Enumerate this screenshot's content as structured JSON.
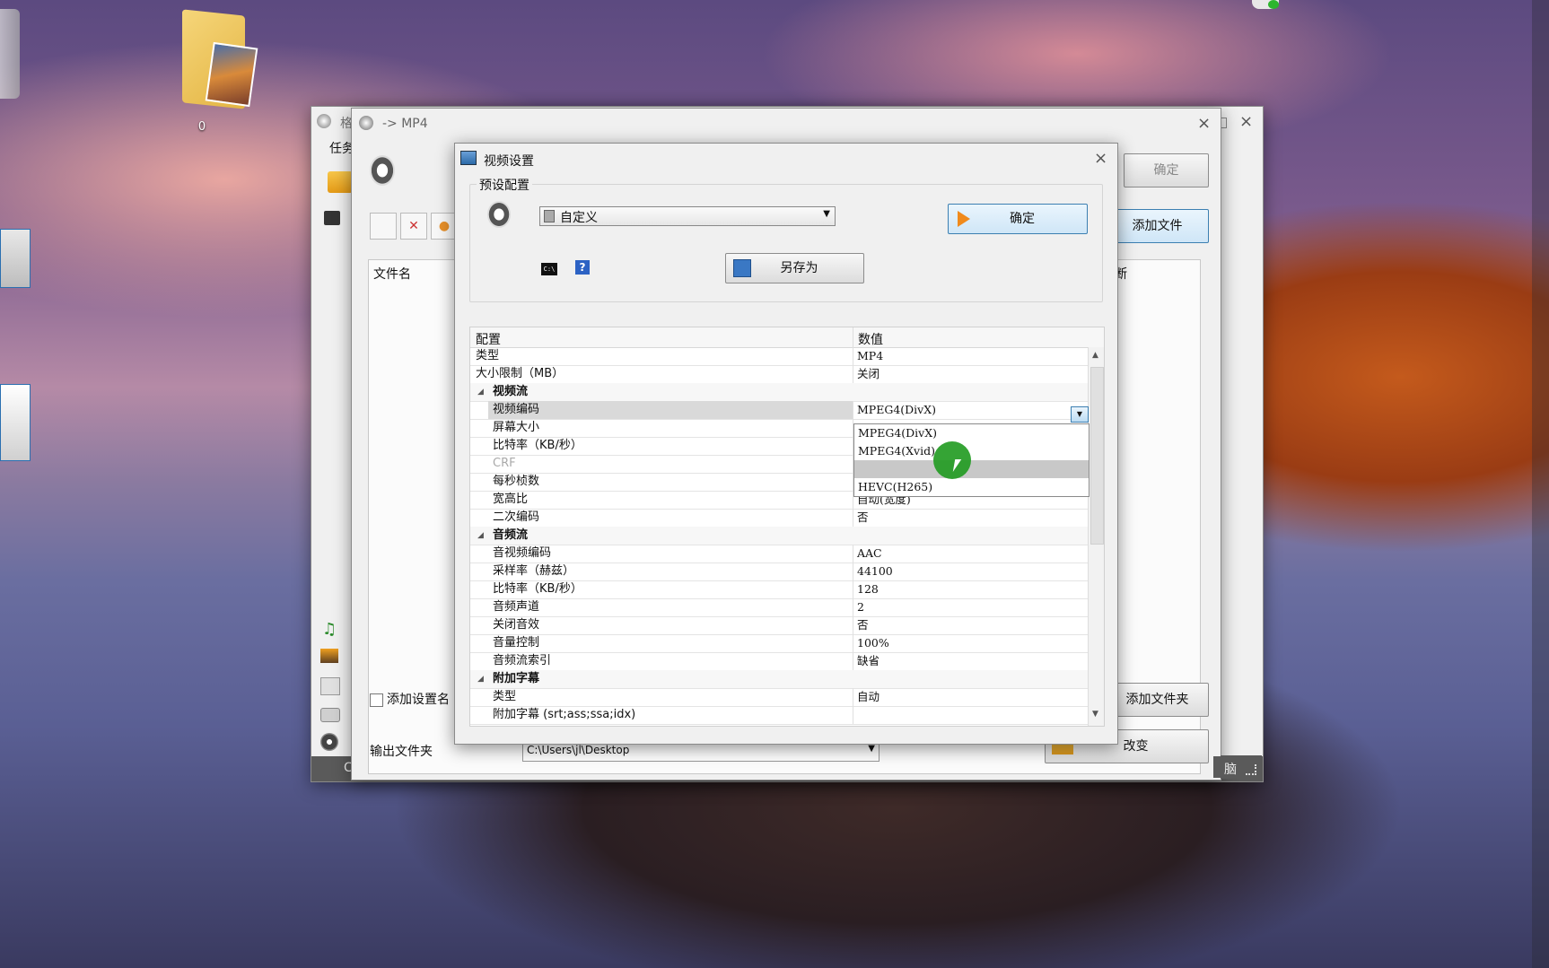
{
  "desktop": {
    "folder_label": "0"
  },
  "back_window": {
    "title": "格",
    "menu_task": "任务"
  },
  "mid_window": {
    "title": "-> MP4",
    "ok_label": "确定",
    "add_file_label": "添加文件",
    "add_folder_label": "添加文件夹",
    "col_filename": "文件名",
    "col_right": "断",
    "add_setting_name": "添加设置名",
    "output_folder_label": "输出文件夹",
    "output_folder_value": "C:\\Users\\jl\\Desktop",
    "change_label": "改变",
    "status_left": "C",
    "status_right": "脑"
  },
  "dialog": {
    "title": "视频设置",
    "preset_group_label": "预设配置",
    "preset_value": "自定义",
    "ok_label": "确定",
    "save_as_label": "另存为",
    "help_label": "?",
    "grid_header_config": "配置",
    "grid_header_value": "数值",
    "rows": [
      {
        "key": "类型",
        "value": "MP4"
      },
      {
        "key": "大小限制（MB）",
        "value": "关闭"
      },
      {
        "category": "视频流"
      },
      {
        "key": "视频编码",
        "value": "MPEG4(DivX)",
        "selected": true
      },
      {
        "key": "屏幕大小",
        "value": ""
      },
      {
        "key": "比特率（KB/秒）",
        "value": ""
      },
      {
        "key": "CRF",
        "value": "",
        "disabled": true
      },
      {
        "key": "每秒桢数",
        "value": ""
      },
      {
        "key": "宽高比",
        "value": "自动(宽度)"
      },
      {
        "key": "二次编码",
        "value": "否"
      },
      {
        "category": "音频流"
      },
      {
        "key": "音视频编码",
        "value": "AAC"
      },
      {
        "key": "采样率（赫兹）",
        "value": "44100"
      },
      {
        "key": "比特率（KB/秒）",
        "value": "128"
      },
      {
        "key": "音频声道",
        "value": "2"
      },
      {
        "key": "关闭音效",
        "value": "否"
      },
      {
        "key": "音量控制",
        "value": "100%"
      },
      {
        "key": "音频流索引",
        "value": "缺省"
      },
      {
        "category": "附加字幕"
      },
      {
        "key": "类型",
        "value": "自动"
      },
      {
        "key": "附加字幕 (srt;ass;ssa;idx)",
        "value": ""
      }
    ],
    "dropdown_options": [
      "MPEG4(DivX)",
      "MPEG4(Xvid)",
      "",
      "HEVC(H265)"
    ],
    "dropdown_highlight_index": 2
  },
  "colors": {
    "dialog_bg": "#f0f0f0",
    "selection": "#c8c8c8",
    "accent_blue": "#3c7fb1",
    "cursor_green": "#1f9a1f"
  }
}
